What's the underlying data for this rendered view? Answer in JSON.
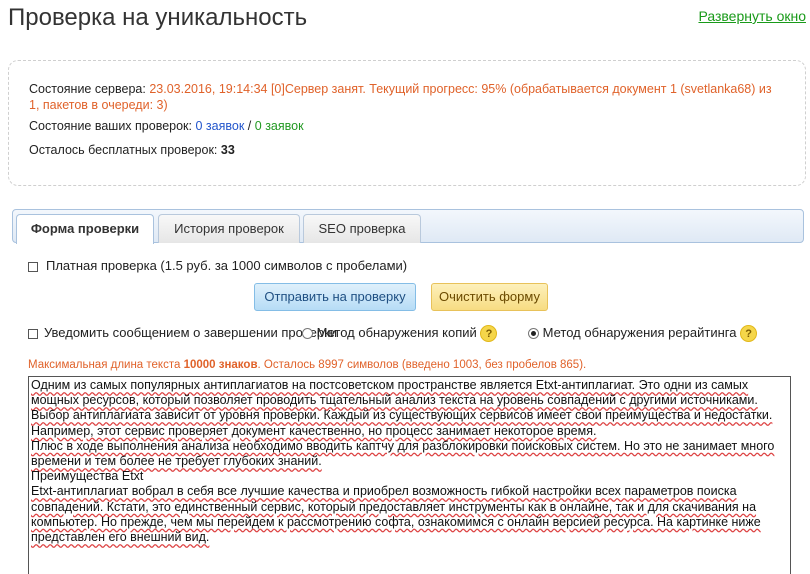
{
  "page": {
    "title": "Проверка на уникальность",
    "expand_link": "Развернуть окно"
  },
  "status": {
    "server_label": "Состояние сервера:",
    "server_value": "23.03.2016, 19:14:34 [0]Сервер занят. Текущий прогресс: 95% (обрабатывается документ 1 (svetlanka68) из 1, пакетов в очереди: 3)",
    "checks_label": "Состояние ваших проверок:",
    "checks_blue": "0 заявок",
    "checks_sep": "/",
    "checks_green": "0 заявок",
    "free_label": "Осталось бесплатных проверок:",
    "free_count": "33"
  },
  "tabs": [
    {
      "label": "Форма проверки",
      "active": true
    },
    {
      "label": "История проверок",
      "active": false
    },
    {
      "label": "SEO проверка",
      "active": false
    }
  ],
  "form": {
    "paid_label": "Платная проверка (1.5 руб. за 1000 символов с пробелами)",
    "paid_checked": false,
    "send_button": "Отправить на проверку",
    "clear_button": "Очистить форму",
    "notify_label": "Уведомить сообщением о завершении проверки",
    "notify_checked": false,
    "method_copies_label": "Метод обнаружения копий",
    "method_rewrite_label": "Метод обнаружения рерайтинга",
    "selected_method": "rewrite",
    "help_glyph": "?",
    "limit_prefix": "Максимальная длина текста",
    "limit_value": "10000 знаков",
    "limit_suffix": ". Осталось 8997 символов (введено 1003, без пробелов 865).",
    "text_lines": [
      "Одним из самых популярных антиплагиатов на постсоветском пространстве является Etxt-антиплагиат. Это одни из самых мощных ресурсов, который позволяет проводить тщательный анализ текста на уровень совпадений с другими источниками.",
      "Выбор антиплагиата зависит от уровня проверки. Каждый из существующих сервисов имеет свои преимущества и недостатки. Например, этот сервис проверяет документ качественно, но процесс занимает некоторое время.",
      "Плюс в ходе выполнения анализа необходимо вводить каптчу для разблокировки поисковых систем. Но это не занимает много времени и тем более не требует глубоких знаний.",
      "Преимущества Etxt",
      "Etxt-антиплагиат вобрал в себя все лучшие качества и приобрел возможность гибкой настройки всех параметров поиска совпадений. Кстати, это единственный сервис, который предоставляет инструменты как в онлайне, так и для скачивания на компьютер. Но прежде, чем мы перейдем к рассмотрению софта, ознакомимся с онлайн версией ресурса. На картинке ниже представлен его внешний вид."
    ]
  },
  "colors": {
    "status_value": "#e0622a",
    "link_green": "#199a19",
    "count_blue": "#2255cc",
    "count_green": "#229922"
  }
}
